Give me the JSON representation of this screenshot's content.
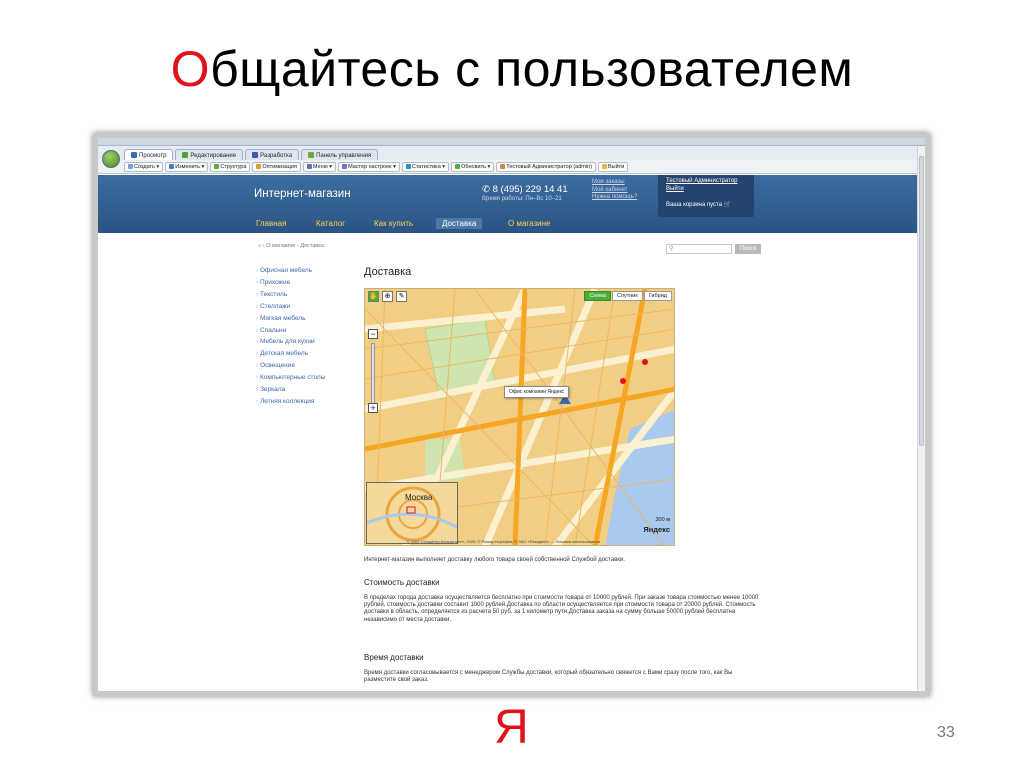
{
  "slide": {
    "title_first": "О",
    "title_rest": "бщайтесь с пользователем",
    "page_number": "33",
    "footer_logo": "Я"
  },
  "browser": {
    "tabs": [
      "Просмотр",
      "Редактирование",
      "Разработка",
      "Панель управления"
    ],
    "toolbar": [
      "Создать",
      "Изменить",
      "Структура",
      "Оптимизация",
      "Меню",
      "Мастер настроек",
      "Статистика",
      "Обновить",
      "Тестовый Администратор (admin)",
      "Выйти"
    ]
  },
  "site": {
    "name": "Интернет-магазин",
    "phone": "8 (495) 229 14 41",
    "hours": "Время работы: Пн–Вс 10–21",
    "user_links": [
      "Мои заказы",
      "Мой кабинет",
      "Нужна помощь?"
    ],
    "admin_name": "Тестовый Администратор",
    "logout": "Выйти",
    "cart": "Ваша корзина пуста",
    "nav": [
      "Главная",
      "Каталог",
      "Как купить",
      "Доставка",
      "О магазине"
    ],
    "breadcrumb": "⌂ › О магазине › Доставка",
    "search_button": "Поиск",
    "menu": [
      "Офисная мебель",
      "Прихожие",
      "Текстиль",
      "Стеллажи",
      "Мягкая мебель",
      "Спальни",
      "Мебель для кухни",
      "Детская мебель",
      "Освещение",
      "Компьютерные столы",
      "Зеркала",
      "Летняя коллекция"
    ],
    "page_heading": "Доставка"
  },
  "map": {
    "modes": [
      "Схема",
      "Спутник",
      "Гибрид"
    ],
    "callout": "Офис компании Яндекс",
    "city": "Москва",
    "scale": "300 м",
    "logo": "Яндекс",
    "copyright": "© ЗАО «Геоцентр-Консалтинг», 2009; © Роскартография; © ЗАО «Резидент» — Условия использования"
  },
  "content": {
    "intro": "Интернет-магазин выполняет доставку любого товара своей собственной Службой доставки.",
    "cost_heading": "Стоимость доставки",
    "cost_text": "В пределах города доставка осуществляется бесплатно при стоимости товара от 10000 рублей. При заказе товара стоимостью менее 10000 рублей, стоимость доставки составит 1000 рублей.Доставка по области осуществляется при стоимости товара от 20000 рублей. Стоимость доставки в область, определяется из расчета 50 руб. за 1 километр пути.Доставка заказа на сумму больше 50000 рублей бесплатна независимо от места доставки.",
    "time_heading": "Время доставки",
    "time_text": "Время доставки согласовывается с менеджером Службы доставки, который обязательно свяжется с Вами сразу после того, как Вы разместите свой заказ."
  },
  "colors": {
    "accent": "#e0131c",
    "header_blue": "#2a5486",
    "nav_yellow": "#ffd34a",
    "link_blue": "#3c6aa8"
  }
}
